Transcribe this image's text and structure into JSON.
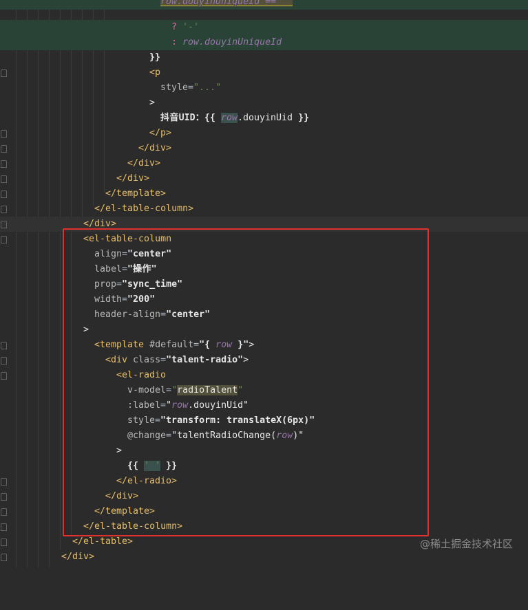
{
  "watermark": "@稀土掘金技术社区",
  "code": {
    "l0_partial": "row.douyinUniqueId == ''",
    "l1_q": "?",
    "l1_dash": "'-'",
    "l2_colon": ":",
    "l2_expr": "row.douyinUniqueId",
    "l3_close": "}}",
    "l4_p": "<p",
    "l5_style_attr": "style",
    "l5_style_val": "\"...\"",
    "l6_gt": ">",
    "l7_label": "抖音UID：",
    "l7_open": "{{",
    "l7_row": "row",
    "l7_prop": ".douyinUid",
    "l7_close": "}}",
    "l8_close_p": "</p>",
    "l9_close_div": "</div>",
    "l10_close_div": "</div>",
    "l11_close_div": "</div>",
    "l12_close_template": "</template>",
    "l13_close_col": "</el-table-column>",
    "l14_close_div": "</div>",
    "l15_open_col": "<el-table-column",
    "l16_attr": "align",
    "l16_val": "\"center\"",
    "l17_attr": "label",
    "l17_val": "\"操作\"",
    "l18_attr": "prop",
    "l18_val": "\"sync_time\"",
    "l19_attr": "width",
    "l19_val": "\"200\"",
    "l20_attr": "header-align",
    "l20_val": "\"center\"",
    "l21_gt": ">",
    "l22_tpl": "<template",
    "l22_attr": "#default",
    "l22_val_a": "\"{ ",
    "l22_val_row": "row",
    "l22_val_b": " }\"",
    "l22_gt": ">",
    "l23_div": "<div",
    "l23_attr": "class",
    "l23_val": "\"talent-radio\"",
    "l23_gt": ">",
    "l24_radio": "<el-radio",
    "l25_attr": "v-model",
    "l25_val": "radioTalent",
    "l26_attr": ":label",
    "l26_row": "row",
    "l26_prop": ".douyinUid",
    "l27_attr": "style",
    "l27_val": "\"transform: translateX(6px)\"",
    "l28_attr": "@change",
    "l28_fn": "talentRadioChange(",
    "l28_row": "row",
    "l28_end": ")\"",
    "l29_gt": ">",
    "l30_open": "{{",
    "l30_str": "' '",
    "l30_close": "}}",
    "l31_close_radio": "</el-radio>",
    "l32_close_div": "</div>",
    "l33_close_tpl": "</template>",
    "l34_close_col": "</el-table-column>",
    "l35_close_table": "</el-table>",
    "l36_close_div": "</div>"
  }
}
